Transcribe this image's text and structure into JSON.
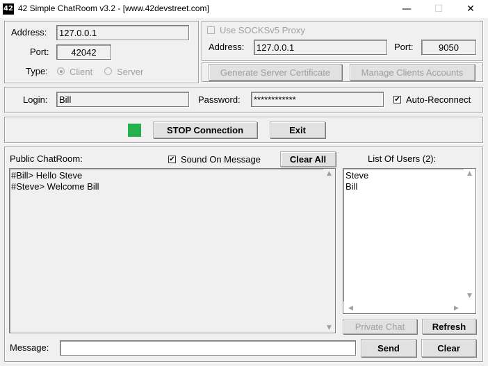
{
  "window": {
    "icon_text": "42",
    "title": "42 Simple ChatRoom v3.2 - [www.42devstreet.com]",
    "minimize_glyph": "—",
    "maximize_glyph": "☐",
    "close_glyph": "✕"
  },
  "server": {
    "address_label": "Address:",
    "address_value": "127.0.0.1",
    "port_label": "Port:",
    "port_value": "42042",
    "type_label": "Type:",
    "type_options": [
      {
        "label": "Client",
        "selected": true
      },
      {
        "label": "Server",
        "selected": false
      }
    ]
  },
  "proxy": {
    "use_label": "Use SOCKSv5 Proxy",
    "use_checked": false,
    "address_label": "Address:",
    "address_value": "127.0.0.1",
    "port_label": "Port:",
    "port_value": "9050",
    "gen_cert_label": "Generate Server Certificate",
    "manage_clients_label": "Manage Clients Accounts"
  },
  "credentials": {
    "login_label": "Login:",
    "login_value": "Bill",
    "password_label": "Password:",
    "password_value": "************",
    "auto_reconnect_label": "Auto-Reconnect",
    "auto_reconnect_checked": true
  },
  "connection": {
    "status_color": "#22b14c",
    "stop_label": "STOP Connection",
    "exit_label": "Exit"
  },
  "chat": {
    "header_label": "Public ChatRoom:",
    "sound_label": "Sound On Message",
    "sound_checked": true,
    "clear_all_label": "Clear All",
    "messages": [
      "#Bill> Hello Steve",
      "#Steve> Welcome Bill"
    ]
  },
  "users": {
    "header_label": "List Of Users (2):",
    "list": [
      "Steve",
      "Bill"
    ],
    "private_chat_label": "Private Chat",
    "refresh_label": "Refresh"
  },
  "message_bar": {
    "label": "Message:",
    "value": "",
    "send_label": "Send",
    "clear_label": "Clear"
  },
  "glyphs": {
    "check": "✔",
    "up": "▲",
    "down": "▼",
    "left": "◀",
    "right": "▶"
  }
}
